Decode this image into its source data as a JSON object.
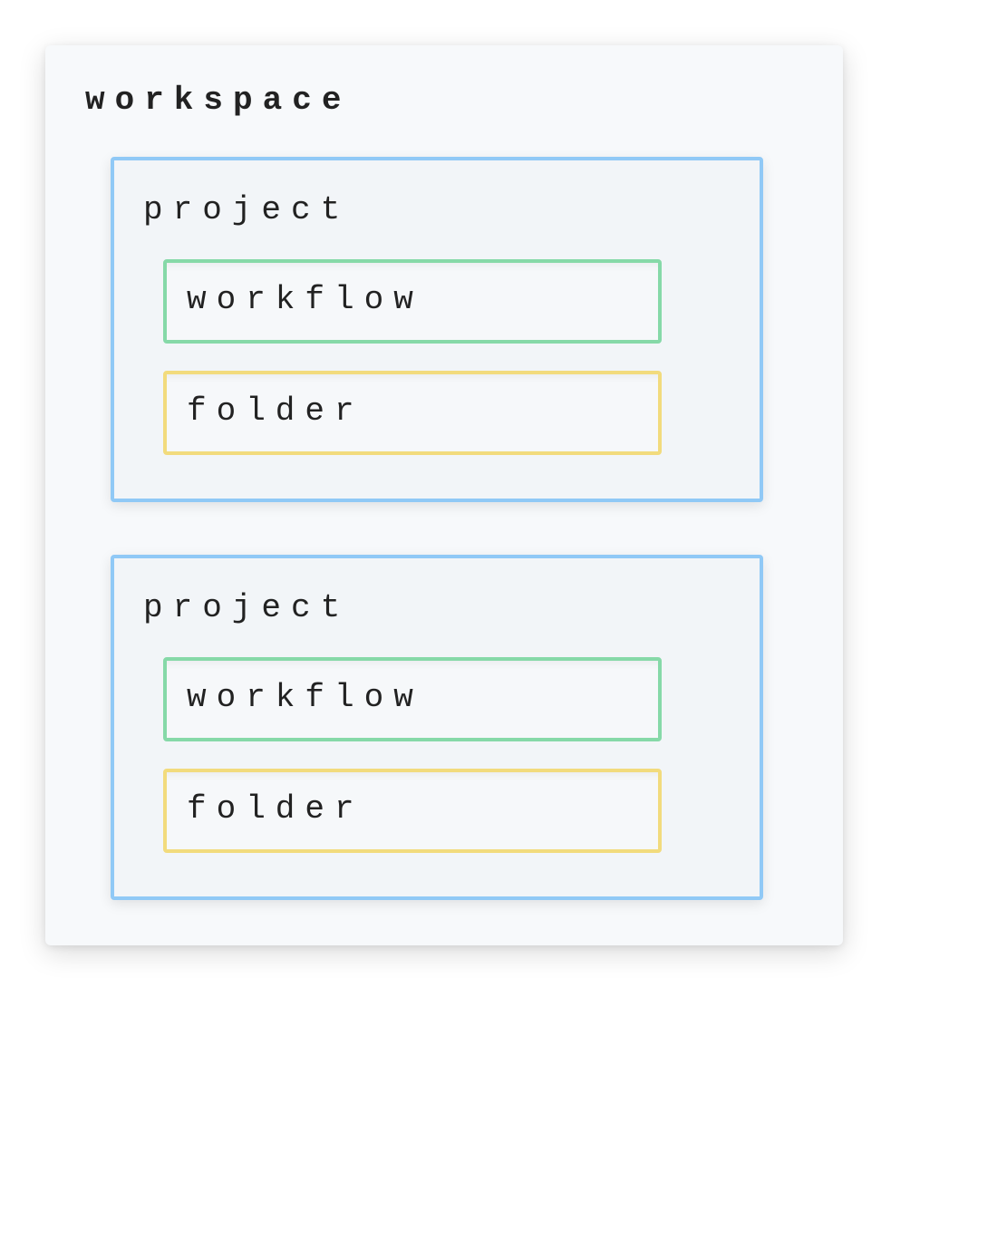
{
  "workspace": {
    "title": "workspace",
    "projects": [
      {
        "title": "project",
        "children": [
          {
            "type": "workflow",
            "label": "workflow"
          },
          {
            "type": "folder",
            "label": "folder"
          }
        ]
      },
      {
        "title": "project",
        "children": [
          {
            "type": "workflow",
            "label": "workflow"
          },
          {
            "type": "folder",
            "label": "folder"
          }
        ]
      }
    ]
  },
  "colors": {
    "project_border": "#90c9f6",
    "workflow_border": "#86d9a8",
    "folder_border": "#f2db7d",
    "panel_bg": "#f7f9fb"
  }
}
